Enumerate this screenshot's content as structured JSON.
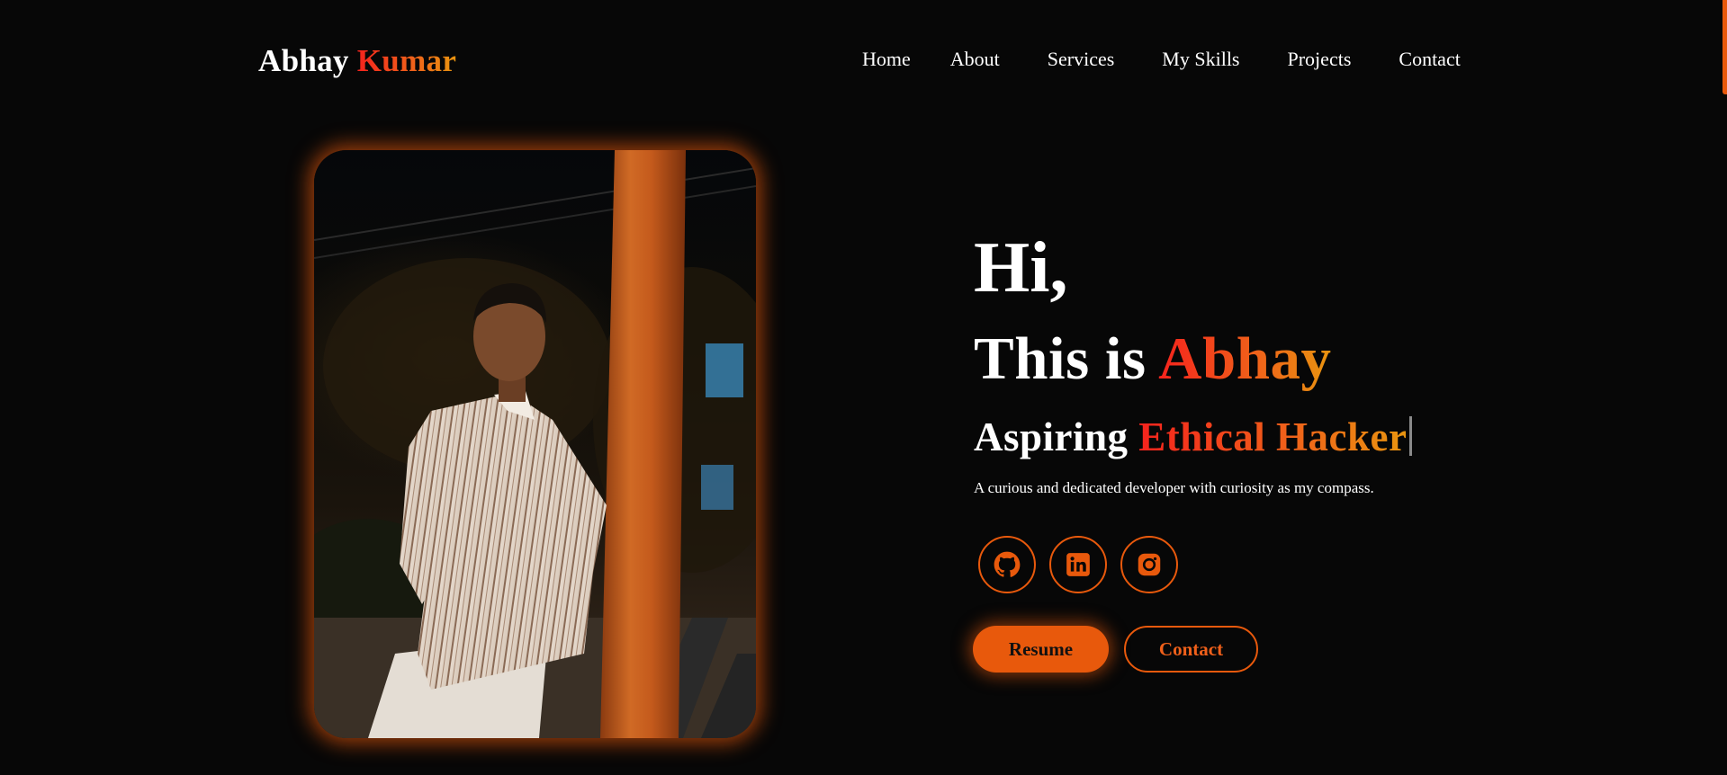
{
  "header": {
    "logo_first": "Abhay",
    "logo_last": "Kumar",
    "nav": [
      "Home",
      "About",
      "Services",
      "My Skills",
      "Projects",
      "Contact"
    ]
  },
  "hero": {
    "greeting": "Hi,",
    "intro_prefix": "This is",
    "intro_name": "Abhay",
    "role_prefix": "Aspiring",
    "role_highlight": "Ethical Hacker",
    "tagline": "A curious and dedicated developer with curiosity as my compass."
  },
  "socials": [
    {
      "icon": "github-icon"
    },
    {
      "icon": "linkedin-icon"
    },
    {
      "icon": "instagram-icon"
    }
  ],
  "buttons": {
    "resume": "Resume",
    "contact": "Contact"
  },
  "colors": {
    "background": "#070707",
    "accent": "#e8590c",
    "gradient_start": "#f5231d",
    "gradient_end": "#e9950f",
    "text": "#ffffff"
  }
}
